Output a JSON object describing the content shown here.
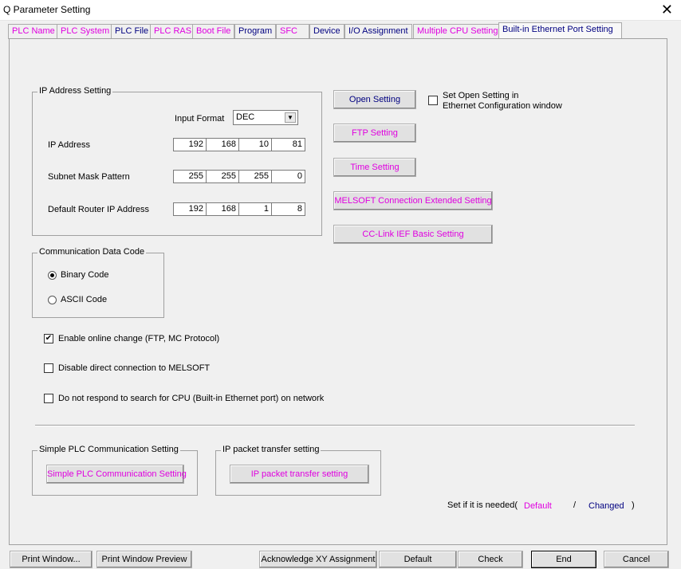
{
  "window": {
    "title": "Q Parameter Setting",
    "close_glyph": "✕"
  },
  "tabs": [
    {
      "label": "PLC Name",
      "color": "#e000e0"
    },
    {
      "label": "PLC System",
      "color": "#e000e0"
    },
    {
      "label": "PLC File",
      "color": "#000080"
    },
    {
      "label": "PLC RAS",
      "color": "#e000e0"
    },
    {
      "label": "Boot File",
      "color": "#e000e0"
    },
    {
      "label": "Program",
      "color": "#000080"
    },
    {
      "label": "SFC",
      "color": "#e000e0"
    },
    {
      "label": "Device",
      "color": "#000080"
    },
    {
      "label": "I/O Assignment",
      "color": "#000080"
    },
    {
      "label": "Multiple CPU Setting",
      "color": "#e000e0"
    },
    {
      "label": "Built-in Ethernet Port Setting",
      "color": "#000080",
      "active": true
    }
  ],
  "ip_setting": {
    "legend": "IP Address Setting",
    "input_format_label": "Input Format",
    "input_format_value": "DEC",
    "ip_address_label": "IP Address",
    "ip_address": [
      "192",
      "168",
      "10",
      "81"
    ],
    "subnet_label": "Subnet Mask Pattern",
    "subnet": [
      "255",
      "255",
      "255",
      "0"
    ],
    "router_label": "Default Router IP Address",
    "router": [
      "192",
      "168",
      "1",
      "8"
    ]
  },
  "right_buttons": {
    "open_setting": "Open Setting",
    "open_setting_check": "Set Open Setting in\nEthernet Configuration window",
    "ftp_setting": "FTP Setting",
    "time_setting": "Time Setting",
    "melsoft_ext": "MELSOFT Connection Extended Setting",
    "cclink": "CC-Link IEF Basic Setting"
  },
  "comm_code": {
    "legend": "Communication Data Code",
    "binary": "Binary Code",
    "ascii": "ASCII Code",
    "selected": "binary"
  },
  "options": {
    "online_change": {
      "label": "Enable online change (FTP, MC Protocol)",
      "checked": true
    },
    "disable_direct": {
      "label": "Disable direct connection to MELSOFT",
      "checked": false
    },
    "no_respond": {
      "label": "Do not respond to search for CPU (Built-in Ethernet port) on network",
      "checked": false
    }
  },
  "simple_plc": {
    "legend": "Simple PLC Communication Setting",
    "button": "Simple PLC Communication Setting"
  },
  "ip_packet": {
    "legend": "IP packet transfer setting",
    "button": "IP packet transfer setting"
  },
  "legend_note": {
    "prefix": "Set if it is needed(",
    "default": "Default",
    "slash": "/",
    "changed": "Changed",
    "suffix": ")"
  },
  "bottom": {
    "print_window": "Print Window...",
    "print_preview": "Print Window Preview",
    "ack_xy": "Acknowledge XY Assignment",
    "default": "Default",
    "check": "Check",
    "end": "End",
    "cancel": "Cancel"
  },
  "colors": {
    "pink": "#e000e0",
    "navy": "#000080"
  }
}
